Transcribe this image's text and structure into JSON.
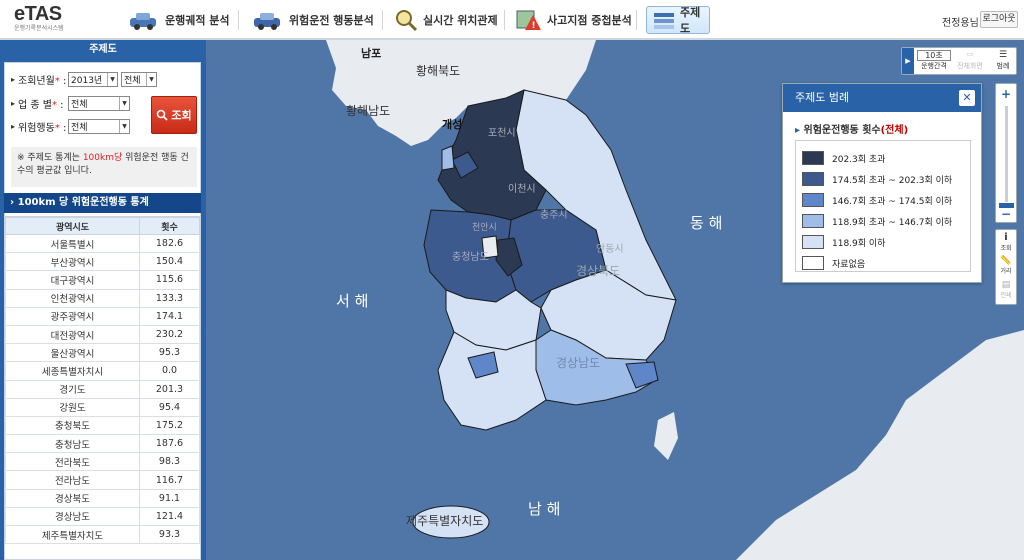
{
  "header": {
    "logo_title": "eTAS",
    "logo_subtitle": "운행기록분석시스템",
    "menu": [
      {
        "label": "운행궤적 분석"
      },
      {
        "label": "위험운전 행동분석"
      },
      {
        "label": "실시간 위치관제"
      },
      {
        "label": "사고지점 중첩분석"
      },
      {
        "label": "주제도"
      }
    ],
    "user": "전정용님",
    "logout": "로그아웃"
  },
  "search": {
    "panel_title": "주제도",
    "year_label": "조회년월",
    "year_value": "2013년",
    "month_value": "전체",
    "industry_label": "업 종 별",
    "industry_value": "전체",
    "behavior_label": "위험행동",
    "behavior_value": "전체",
    "button": "조회",
    "note_pre": "※ 주제도 통계는 ",
    "note_hl": "100km당",
    "note_post": " 위험운전 행동 건수의 평균값 입니다."
  },
  "stats": {
    "title": "100km 당 위험운전행동 통계",
    "col_region": "광역시도",
    "col_count": "횟수",
    "rows": [
      {
        "region": "서울특별시",
        "count": "182.6"
      },
      {
        "region": "부산광역시",
        "count": "150.4"
      },
      {
        "region": "대구광역시",
        "count": "115.6"
      },
      {
        "region": "인천광역시",
        "count": "133.3"
      },
      {
        "region": "광주광역시",
        "count": "174.1"
      },
      {
        "region": "대전광역시",
        "count": "230.2"
      },
      {
        "region": "울산광역시",
        "count": "95.3"
      },
      {
        "region": "세종특별자치시",
        "count": "0.0"
      },
      {
        "region": "경기도",
        "count": "201.3"
      },
      {
        "region": "강원도",
        "count": "95.4"
      },
      {
        "region": "충청북도",
        "count": "175.2"
      },
      {
        "region": "충청남도",
        "count": "187.6"
      },
      {
        "region": "전라북도",
        "count": "98.3"
      },
      {
        "region": "전라남도",
        "count": "116.7"
      },
      {
        "region": "경상북도",
        "count": "91.1"
      },
      {
        "region": "경상남도",
        "count": "121.4"
      },
      {
        "region": "제주특별자치도",
        "count": "93.3"
      }
    ]
  },
  "map": {
    "labels": {
      "nampo": "남포",
      "hwanghae_north": "황해북도",
      "hwanghae_south": "황해남도",
      "kaesong": "개성",
      "east_sea": "동 해",
      "west_sea": "서 해",
      "south_sea": "남 해",
      "jeju": "제주특별자치도",
      "pocheon": "포천시",
      "icheon": "이천시",
      "chungju": "충주시",
      "cheonan": "천안시",
      "andong": "안동시",
      "gyeongsangbukdo": "경상북도",
      "gyeongsangnamdo": "경상남도",
      "chungnam": "충청남도"
    }
  },
  "legend": {
    "title": "주제도 범례",
    "subtitle": "위험운전행동 횟수",
    "subtitle_red": "(전체)",
    "items": [
      {
        "label": "202.3회 초과",
        "color": "#2b3a52"
      },
      {
        "label": "174.5회 초과 ~ 202.3회 이하",
        "color": "#3d5a8e"
      },
      {
        "label": "146.7회 초과 ~ 174.5회 이하",
        "color": "#5e86c8"
      },
      {
        "label": "118.9회 초과 ~ 146.7회 이하",
        "color": "#9fbde9"
      },
      {
        "label": "118.9회 이하",
        "color": "#d5e2f6"
      },
      {
        "label": "자료없음",
        "color": "#ffffff"
      }
    ]
  },
  "tools": {
    "interval_value": "10초",
    "interval_label": "운행간격",
    "full_label": "전체화면",
    "legend_btn": "범례",
    "query_btn": "조회",
    "distance_btn": "거리",
    "print_btn": "인쇄"
  }
}
